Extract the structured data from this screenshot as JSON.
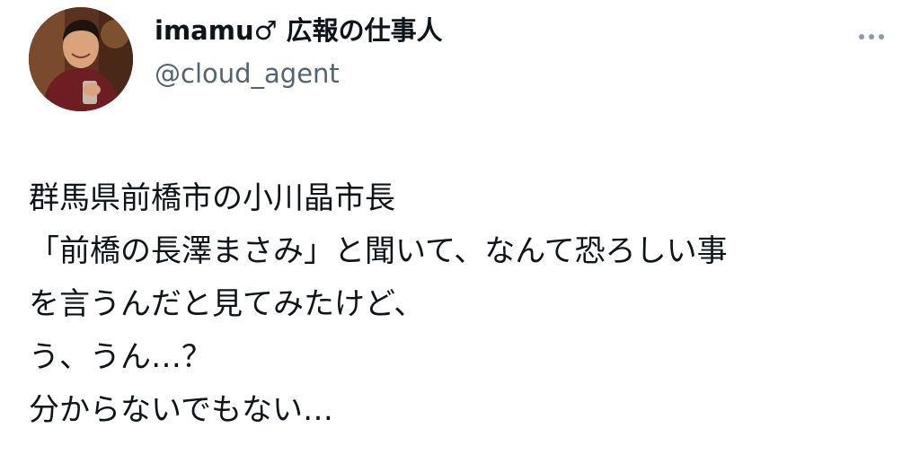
{
  "tweet": {
    "display_name": "imamu♂ 広報の仕事人",
    "handle": "@cloud_agent",
    "more_icon": "more-horizontal-icon",
    "lines": [
      "群馬県前橋市の小川晶市長",
      "「前橋の長澤まさみ」と聞いて、なんて恐ろしい事",
      "を言うんだと見てみたけど、",
      "う、うん…？",
      "分からないでもない…"
    ]
  },
  "colors": {
    "text": "#0f1419",
    "secondary": "#536471",
    "icon": "#8b98a5",
    "background": "#ffffff"
  }
}
